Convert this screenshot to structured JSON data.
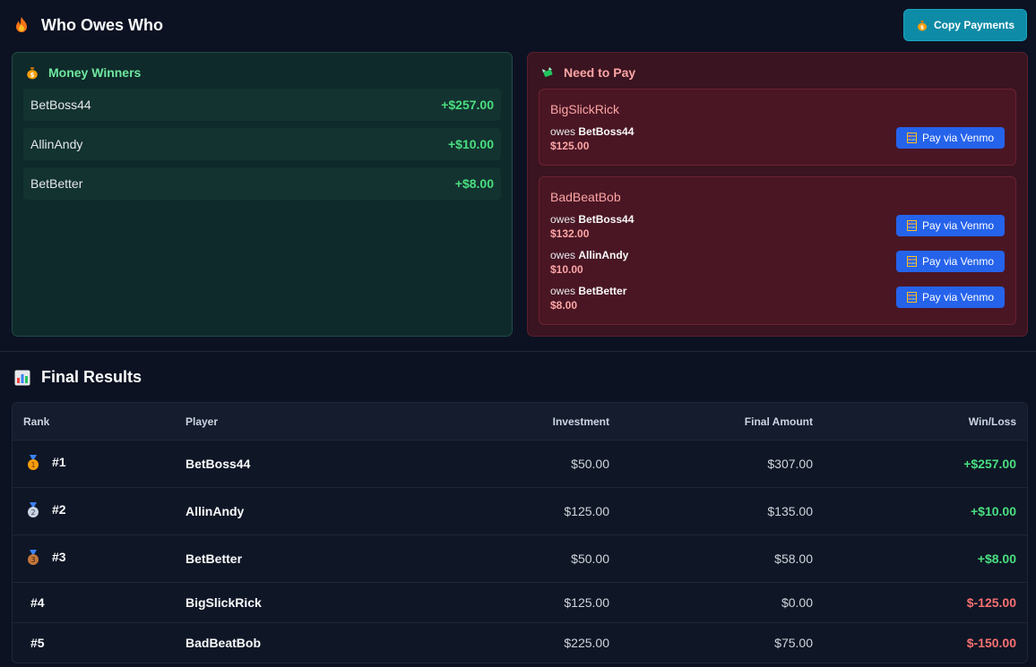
{
  "header": {
    "title": "Who Owes Who",
    "copy_button": "Copy Payments"
  },
  "winners": {
    "title": "Money Winners",
    "items": [
      {
        "name": "BetBoss44",
        "amount": "+$257.00"
      },
      {
        "name": "AllinAndy",
        "amount": "+$10.00"
      },
      {
        "name": "BetBetter",
        "amount": "+$8.00"
      }
    ]
  },
  "payers": {
    "title": "Need to Pay",
    "venmo_label": "Pay via Venmo",
    "owes_prefix": "owes",
    "debtors": [
      {
        "name": "BigSlickRick",
        "debts": [
          {
            "to": "BetBoss44",
            "amount": "$125.00"
          }
        ]
      },
      {
        "name": "BadBeatBob",
        "debts": [
          {
            "to": "BetBoss44",
            "amount": "$132.00"
          },
          {
            "to": "AllinAndy",
            "amount": "$10.00"
          },
          {
            "to": "BetBetter",
            "amount": "$8.00"
          }
        ]
      }
    ]
  },
  "results": {
    "title": "Final Results",
    "columns": [
      "Rank",
      "Player",
      "Investment",
      "Final Amount",
      "Win/Loss"
    ],
    "rows": [
      {
        "rank": "#1",
        "medal": "gold-medal-icon",
        "player": "BetBoss44",
        "investment": "$50.00",
        "final": "$307.00",
        "winloss": "+$257.00"
      },
      {
        "rank": "#2",
        "medal": "silver-medal-icon",
        "player": "AllinAndy",
        "investment": "$125.00",
        "final": "$135.00",
        "winloss": "+$10.00"
      },
      {
        "rank": "#3",
        "medal": "bronze-medal-icon",
        "player": "BetBetter",
        "investment": "$50.00",
        "final": "$58.00",
        "winloss": "+$8.00"
      },
      {
        "rank": "#4",
        "medal": "",
        "player": "BigSlickRick",
        "investment": "$125.00",
        "final": "$0.00",
        "winloss": "$-125.00"
      },
      {
        "rank": "#5",
        "medal": "",
        "player": "BadBeatBob",
        "investment": "$225.00",
        "final": "$75.00",
        "winloss": "$-150.00"
      }
    ]
  },
  "colors": {
    "background": "#0c1222",
    "positive": "#4ade80",
    "negative": "#f87171",
    "accent": "#0e8ba6",
    "venmo": "#2563eb"
  }
}
